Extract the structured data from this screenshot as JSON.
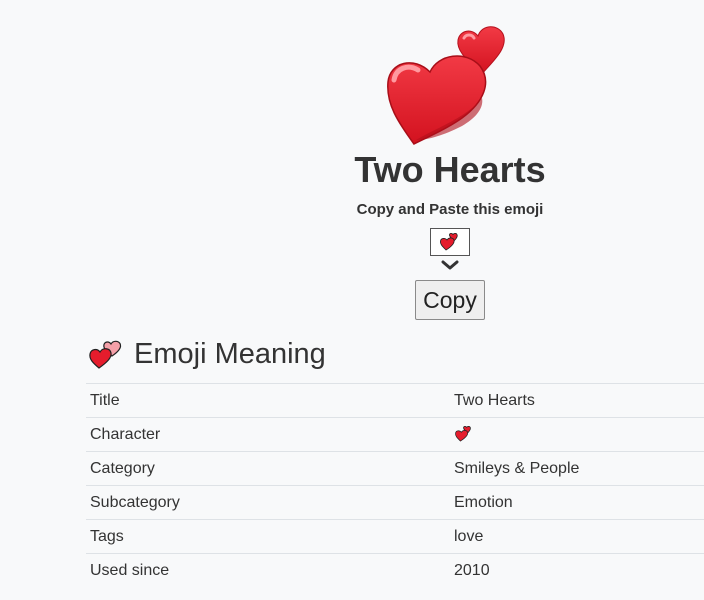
{
  "emoji": {
    "title": "Two Hearts",
    "copy_prompt": "Copy and Paste this emoji",
    "copy_button_label": "Copy",
    "accent_color": "#e51c2c"
  },
  "meaning": {
    "heading": "Emoji Meaning",
    "rows": [
      {
        "label": "Title",
        "value": "Two Hearts"
      },
      {
        "label": "Character",
        "value": ""
      },
      {
        "label": "Category",
        "value": "Smileys & People"
      },
      {
        "label": "Subcategory",
        "value": "Emotion"
      },
      {
        "label": "Tags",
        "value": "love"
      },
      {
        "label": "Used since",
        "value": "2010"
      }
    ]
  }
}
